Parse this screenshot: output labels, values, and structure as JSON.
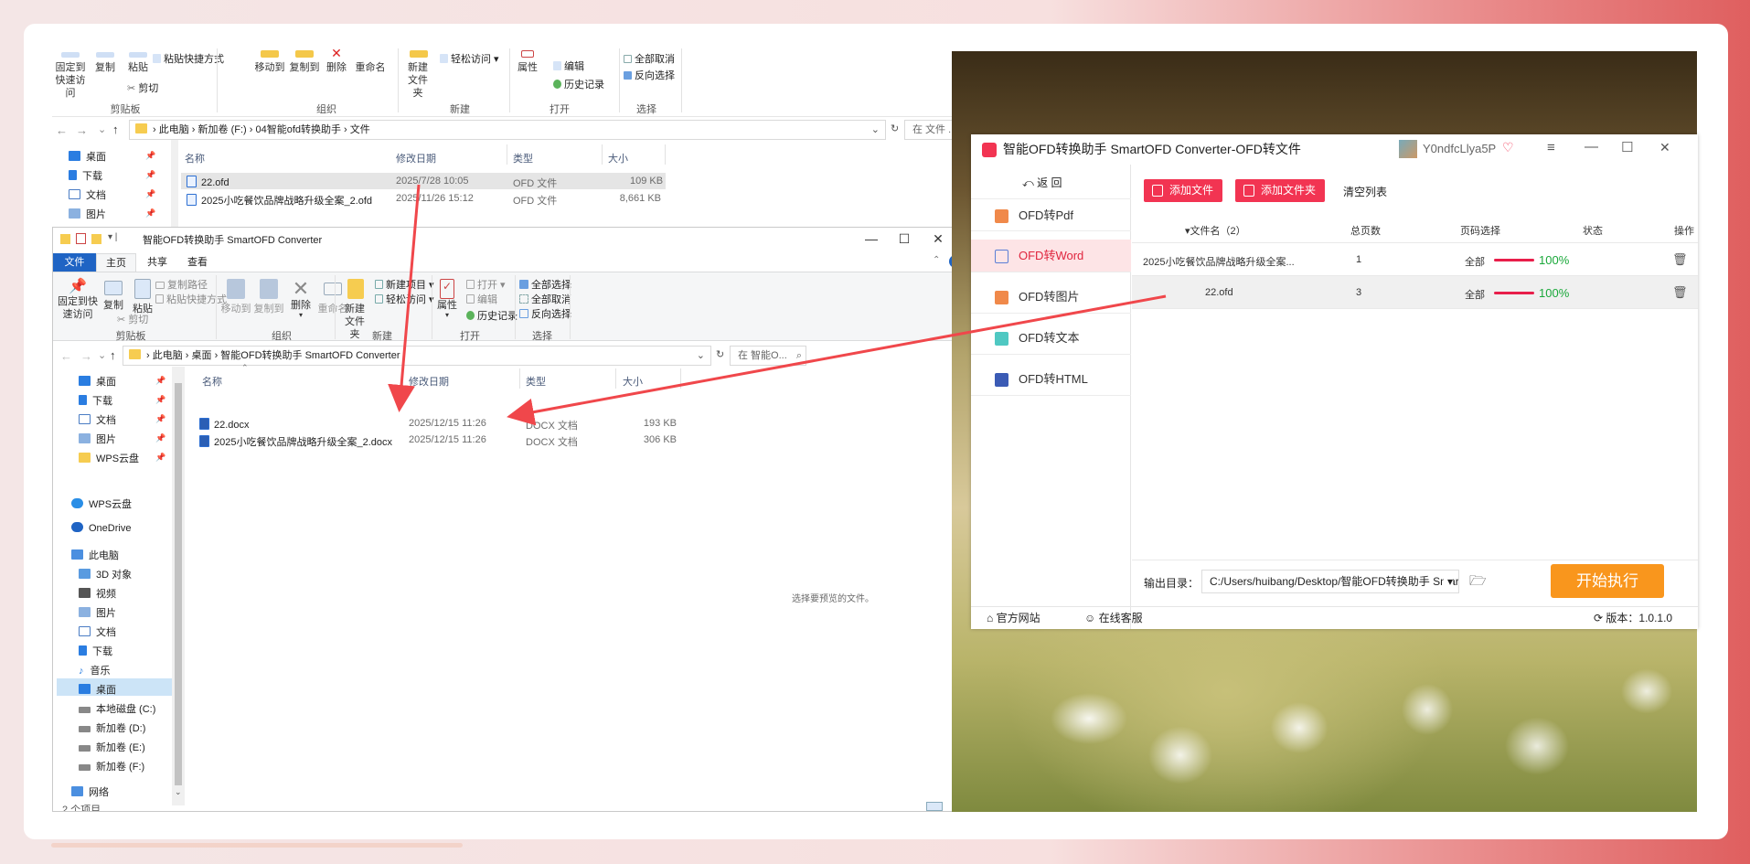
{
  "back_explorer": {
    "ribbon": {
      "pin_quick": "固定到快速访问",
      "copy": "复制",
      "paste": "粘贴",
      "paste_shortcut": "粘贴快捷方式",
      "cut": "剪切",
      "move_to": "移动到",
      "copy_to": "复制到",
      "delete": "删除",
      "rename": "重命名",
      "new_folder": "新建文件夹",
      "easy_access": "轻松访问",
      "properties": "属性",
      "edit": "编辑",
      "history": "历史记录",
      "select_all_none": "全部取消",
      "invert_select": "反向选择",
      "groups": {
        "clipboard": "剪贴板",
        "organize": "组织",
        "new": "新建",
        "open": "打开",
        "select": "选择"
      }
    },
    "address": [
      "此电脑",
      "新加卷 (F:)",
      "04智能ofd转换助手",
      "文件"
    ],
    "search_placeholder": "在 文件 ...",
    "nav": [
      "桌面",
      "下载",
      "文档",
      "图片"
    ],
    "columns": {
      "name": "名称",
      "date": "修改日期",
      "type": "类型",
      "size": "大小"
    },
    "files": [
      {
        "name": "22.ofd",
        "date": "2025/7/28 10:05",
        "type": "OFD 文件",
        "size": "109 KB"
      },
      {
        "name": "2025小吃餐饮品牌战略升级全案_2.ofd",
        "date": "2025/11/26 15:12",
        "type": "OFD 文件",
        "size": "8,661 KB"
      }
    ]
  },
  "front_explorer": {
    "title": "智能OFD转换助手 SmartOFD Converter",
    "tabs": {
      "file": "文件",
      "home": "主页",
      "share": "共享",
      "view": "查看"
    },
    "ribbon": {
      "pin_quick": "固定到快速访问",
      "copy": "复制",
      "paste": "粘贴",
      "copy_path": "复制路径",
      "paste_shortcut": "粘贴快捷方式",
      "cut": "剪切",
      "move_to": "移动到",
      "copy_to": "复制到",
      "delete": "删除",
      "rename": "重命名",
      "new_folder": "新建文件夹",
      "new_item": "新建项目",
      "easy_access": "轻松访问",
      "properties": "属性",
      "open": "打开",
      "edit": "编辑",
      "history": "历史记录",
      "select_all": "全部选择",
      "select_none": "全部取消",
      "invert_select": "反向选择",
      "groups": {
        "clipboard": "剪贴板",
        "organize": "组织",
        "new": "新建",
        "open": "打开",
        "select": "选择"
      }
    },
    "address": [
      "此电脑",
      "桌面",
      "智能OFD转换助手 SmartOFD Converter"
    ],
    "search_placeholder": "在 智能O...",
    "nav": {
      "quick": [
        "桌面",
        "下载",
        "文档",
        "图片",
        "WPS云盘"
      ],
      "wps_cloud": "WPS云盘",
      "onedrive": "OneDrive",
      "this_pc": "此电脑",
      "pc_items": [
        "3D 对象",
        "视频",
        "图片",
        "文档",
        "下载",
        "音乐",
        "桌面",
        "本地磁盘 (C:)",
        "新加卷 (D:)",
        "新加卷 (E:)",
        "新加卷 (F:)"
      ],
      "network": "网络"
    },
    "columns": {
      "name": "名称",
      "date": "修改日期",
      "type": "类型",
      "size": "大小"
    },
    "files": [
      {
        "name": "22.docx",
        "date": "2025/12/15 11:26",
        "type": "DOCX 文档",
        "size": "193 KB"
      },
      {
        "name": "2025小吃餐饮品牌战略升级全案_2.docx",
        "date": "2025/12/15 11:26",
        "type": "DOCX 文档",
        "size": "306 KB"
      }
    ],
    "preview_hint": "选择要预览的文件。",
    "status": "2 个项目"
  },
  "app": {
    "title": "智能OFD转换助手 SmartOFD Converter-OFD转文件",
    "user": "Y0ndfcLlya5P",
    "back": "返 回",
    "menu": [
      {
        "label": "OFD转Pdf",
        "icon": "pdf-icon"
      },
      {
        "label": "OFD转Word",
        "icon": "word-icon"
      },
      {
        "label": "OFD转图片",
        "icon": "image-icon"
      },
      {
        "label": "OFD转文本",
        "icon": "text-icon"
      },
      {
        "label": "OFD转HTML",
        "icon": "html-icon"
      }
    ],
    "active_menu": "OFD转Word",
    "add_file": "添加文件",
    "add_folder": "添加文件夹",
    "clear_list": "清空列表",
    "table": {
      "headers": {
        "name": "文件名（2）",
        "pages": "总页数",
        "range": "页码选择",
        "status": "状态",
        "action": "操作"
      },
      "rows": [
        {
          "name": "2025小吃餐饮品牌战略升级全案...",
          "pages": "1",
          "range": "全部",
          "progress": 1.0,
          "pct": "100%"
        },
        {
          "name": "22.ofd",
          "pages": "3",
          "range": "全部",
          "progress": 1.0,
          "pct": "100%"
        }
      ]
    },
    "output_label": "输出目录：",
    "output_path": "C:/Users/huibang/Desktop/智能OFD转换助手 Smart",
    "run": "开始执行",
    "footer": {
      "website": "官方网站",
      "support": "在线客服",
      "version": "版本：1.0.1.0"
    }
  },
  "colors": {
    "accent": "#f23452",
    "run": "#f9961d",
    "progress": "#e81e4a",
    "done": "#1aa83a",
    "arrow": "#f0474b"
  }
}
